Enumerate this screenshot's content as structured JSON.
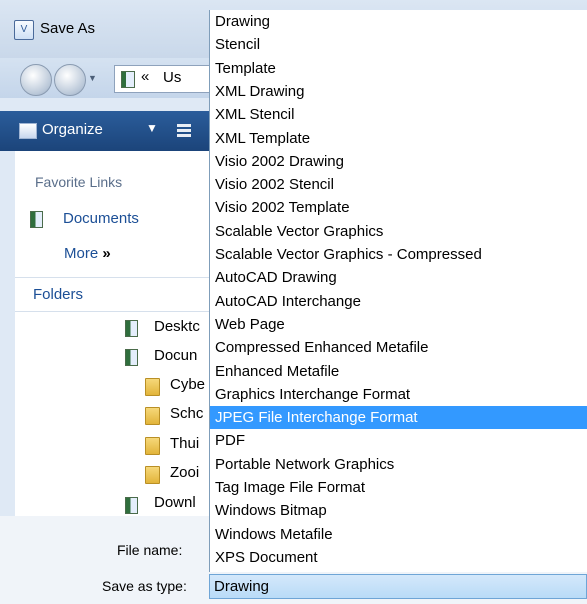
{
  "window": {
    "title": "Save As"
  },
  "address": {
    "chevron": "«",
    "path_text": "Us"
  },
  "toolbar": {
    "organize_label": "Organize",
    "organize_caret": "▼"
  },
  "navpane": {
    "favorite_links_heading": "Favorite Links",
    "documents_link": "Documents",
    "more_link": "More",
    "more_chevron": "»",
    "folders_heading": "Folders",
    "tree": [
      {
        "label": "Desktc",
        "icon": "library-icon"
      },
      {
        "label": "Docun",
        "icon": "library-icon"
      },
      {
        "label": "Cybe",
        "icon": "folder-icon"
      },
      {
        "label": "Schc",
        "icon": "folder-icon"
      },
      {
        "label": "Thui",
        "icon": "folder-icon"
      },
      {
        "label": "Zooi",
        "icon": "folder-icon"
      },
      {
        "label": "Downl",
        "icon": "library-icon"
      }
    ]
  },
  "bottom": {
    "file_name_label": "File name:",
    "save_as_type_label": "Save as type:",
    "save_as_type_value": "Drawing"
  },
  "dropdown": {
    "selected_index": 17,
    "items": [
      "Drawing",
      "Stencil",
      "Template",
      "XML Drawing",
      "XML Stencil",
      "XML Template",
      "Visio 2002 Drawing",
      "Visio 2002 Stencil",
      "Visio 2002 Template",
      "Scalable Vector Graphics",
      "Scalable Vector Graphics - Compressed",
      "AutoCAD Drawing",
      "AutoCAD Interchange",
      "Web Page",
      "Compressed Enhanced Metafile",
      "Enhanced Metafile",
      "Graphics Interchange Format",
      "JPEG File Interchange Format",
      "PDF",
      "Portable Network Graphics",
      "Tag Image File Format",
      "Windows Bitmap",
      "Windows Metafile",
      "XPS Document"
    ]
  },
  "colors": {
    "selection": "#3399ff",
    "toolbar": "#1b447a",
    "link": "#1c4f96"
  }
}
